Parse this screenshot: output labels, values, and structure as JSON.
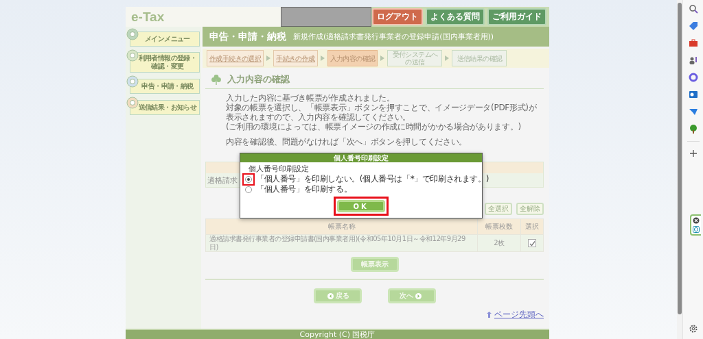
{
  "header": {
    "logo": "e-Tax",
    "buttons": [
      {
        "label": "ログアウト",
        "kind": "logout"
      },
      {
        "label": "よくある質問",
        "kind": "nav"
      },
      {
        "label": "ご利用ガイド",
        "kind": "nav"
      }
    ]
  },
  "sidebar": {
    "items": [
      {
        "label": "メインメニュー"
      },
      {
        "label": "利用者情報の登録・確認・変更"
      },
      {
        "label": "申告・申請・納税"
      },
      {
        "label": "送信結果・お知らせ"
      }
    ]
  },
  "title": {
    "main": "申告・申請・納税",
    "sub": "新規作成(適格請求書発行事業者の登録申請(国内事業者用))"
  },
  "steps": [
    {
      "label": "作成手続きの選択",
      "selected": false,
      "disabled": false
    },
    {
      "label": "手続きの作成",
      "selected": false,
      "disabled": false
    },
    {
      "label": "入力内容の確認",
      "selected": true,
      "disabled": false
    },
    {
      "label": "受付システムへの送信",
      "selected": false,
      "disabled": true
    },
    {
      "label": "送信結果の確認",
      "selected": false,
      "disabled": true
    }
  ],
  "heading": "入力内容の確認",
  "instructions": [
    "入力した内容に基づき帳票が作成されました。",
    "対象の帳票を選択し、「帳票表示」ボタンを押すことで、イメージデータ(PDF形式)が表示されますので、入力内容を確認してください。",
    "(ご利用の環境によっては、帳票イメージの作成に時間がかかる場合があります。)",
    "内容を確認後、問題がなければ「次へ」ボタンを押してください。"
  ],
  "covered_table": {
    "row_text": "適格請求"
  },
  "select_buttons": [
    "全選択",
    "全解除"
  ],
  "forms_table": {
    "columns": [
      "帳票名称",
      "帳票枚数",
      "選択"
    ],
    "rows": [
      {
        "name": "適格請求書発行事業者の登録申請書(国内事業者用)(令和05年10月1日～令和12年9月29日)",
        "count": "2枚",
        "checked": true
      }
    ]
  },
  "view_button": "帳票表示",
  "nav_buttons": [
    {
      "label": "戻る",
      "kind": "back"
    },
    {
      "label": "次へ",
      "kind": "next"
    }
  ],
  "top_link": "ページ先頭へ",
  "footer": "Copyright (C) 国税庁",
  "dialog": {
    "title": "個人番号印刷設定",
    "label": "個人番号印刷設定",
    "options": [
      {
        "label": "「個人番号」を印刷しない。(個人番号は「*」で印刷されます。)",
        "selected": true
      },
      {
        "label": "「個人番号」を印刷する。",
        "selected": false
      }
    ],
    "ok": "OK"
  }
}
